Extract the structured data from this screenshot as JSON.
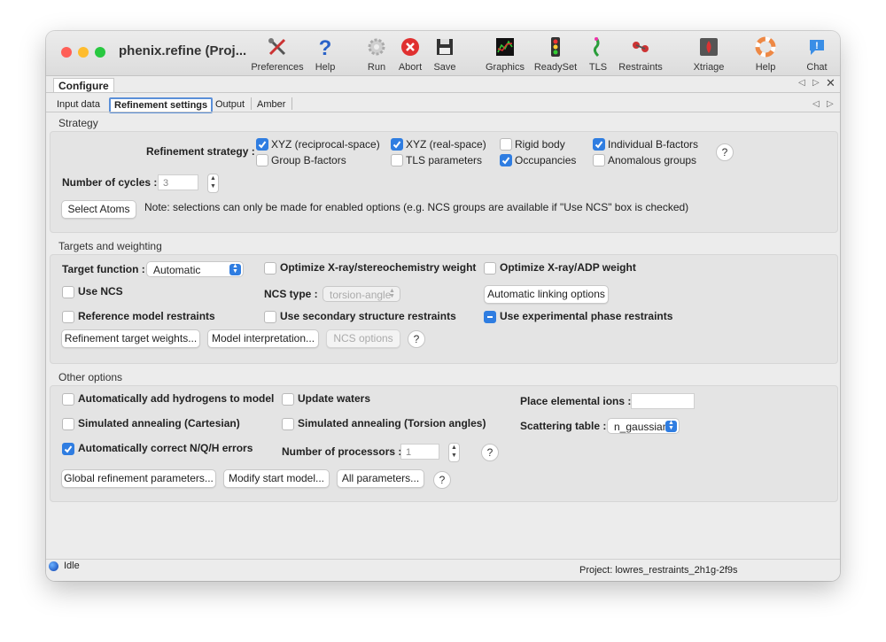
{
  "window": {
    "title": "phenix.refine (Proj..."
  },
  "toolbar": [
    {
      "name": "preferences",
      "label": "Preferences"
    },
    {
      "name": "help",
      "label": "Help"
    },
    {
      "name": "run",
      "label": "Run"
    },
    {
      "name": "abort",
      "label": "Abort"
    },
    {
      "name": "save",
      "label": "Save"
    },
    {
      "name": "graphics",
      "label": "Graphics"
    },
    {
      "name": "readyset",
      "label": "ReadySet"
    },
    {
      "name": "tls",
      "label": "TLS"
    },
    {
      "name": "restraints",
      "label": "Restraints"
    },
    {
      "name": "xtriage",
      "label": "Xtriage"
    },
    {
      "name": "help2",
      "label": "Help"
    },
    {
      "name": "chat",
      "label": "Chat"
    }
  ],
  "configure_tab": "Configure",
  "tabs": [
    "Input data",
    "Refinement settings",
    "Output",
    "Amber"
  ],
  "active_tab": "Refinement settings",
  "strategy": {
    "section": "Strategy",
    "label": "Refinement strategy :",
    "options": [
      {
        "label": "XYZ (reciprocal-space)",
        "checked": true
      },
      {
        "label": "XYZ (real-space)",
        "checked": true
      },
      {
        "label": "Rigid body",
        "checked": false
      },
      {
        "label": "Individual B-factors",
        "checked": true
      },
      {
        "label": "Group B-factors",
        "checked": false
      },
      {
        "label": "TLS parameters",
        "checked": false
      },
      {
        "label": "Occupancies",
        "checked": true
      },
      {
        "label": "Anomalous groups",
        "checked": false
      }
    ],
    "help": "?",
    "cycles_label": "Number of cycles :",
    "cycles_value": "3",
    "select_atoms": "Select Atoms",
    "note": "Note: selections can only be made for enabled options (e.g. NCS groups are available if \"Use NCS\" box is checked)"
  },
  "targets": {
    "section": "Targets and weighting",
    "target_function_label": "Target function :",
    "target_function_value": "Automatic",
    "opt_xray_stereo": {
      "label": "Optimize X-ray/stereochemistry weight",
      "checked": false
    },
    "opt_xray_adp": {
      "label": "Optimize X-ray/ADP weight",
      "checked": false
    },
    "use_ncs": {
      "label": "Use NCS",
      "checked": false
    },
    "ncs_type_label": "NCS type :",
    "ncs_type_value": "torsion-angle",
    "auto_linking": "Automatic linking options",
    "ref_model": {
      "label": "Reference model restraints",
      "checked": false
    },
    "secondary": {
      "label": "Use secondary structure restraints",
      "checked": false
    },
    "exp_phase": {
      "label": "Use experimental phase restraints",
      "checked": "mixed"
    },
    "btn_target_weights": "Refinement target weights...",
    "btn_model_interp": "Model interpretation...",
    "btn_ncs_options": "NCS options",
    "help": "?"
  },
  "other": {
    "section": "Other options",
    "add_h": {
      "label": "Automatically add hydrogens to model",
      "checked": false
    },
    "update_waters": {
      "label": "Update waters",
      "checked": false
    },
    "place_ions_label": "Place elemental ions :",
    "place_ions_value": "",
    "sa_cart": {
      "label": "Simulated annealing (Cartesian)",
      "checked": false
    },
    "sa_torsion": {
      "label": "Simulated annealing (Torsion angles)",
      "checked": false
    },
    "scattering_label": "Scattering table :",
    "scattering_value": "n_gaussian",
    "nqh": {
      "label": "Automatically correct N/Q/H errors",
      "checked": true
    },
    "nproc_label": "Number of processors :",
    "nproc_value": "1",
    "help": "?",
    "btn_global": "Global refinement parameters...",
    "btn_modify": "Modify start model...",
    "btn_all": "All parameters...",
    "help2": "?"
  },
  "status": {
    "state": "Idle",
    "project": "Project: lowres_restraints_2h1g-2f9s"
  },
  "colors": {
    "accent": "#2f7de1",
    "close": "#ff5f57",
    "minimize": "#febc2e",
    "zoom": "#28c840"
  }
}
